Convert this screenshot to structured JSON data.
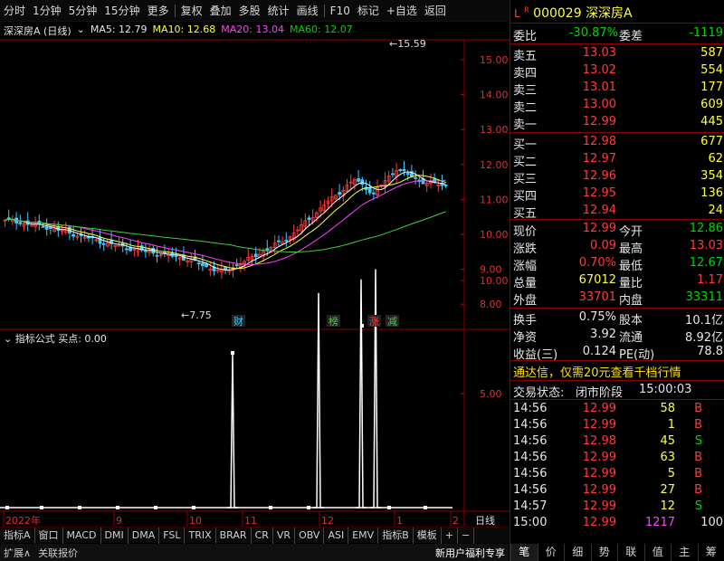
{
  "toolbar": {
    "items": [
      "分时",
      "1分钟",
      "5分钟",
      "15分钟",
      "更多",
      "复权",
      "叠加",
      "多股",
      "统计",
      "画线",
      "F10",
      "标记",
      "+自选",
      "返回"
    ]
  },
  "chart": {
    "stock": "深深房A (日线)",
    "ma5": "MA5: 12.79",
    "ma10": "MA10: 12.68",
    "ma20": "MA20: 13.04",
    "ma60": "MA60: 12.07",
    "high_label": "15.59",
    "low_label": "7.75",
    "price_ticks": [
      "15.00",
      "14.00",
      "13.00",
      "12.00",
      "11.00",
      "10.00",
      "9.00",
      "8.00"
    ],
    "events": [
      "财",
      "榜",
      "涨",
      "减"
    ],
    "indicator_title": "指标公式",
    "indicator_value": "买点: 0.00",
    "ind_ticks": [
      "10.00",
      "5.00"
    ],
    "date_labels": [
      "2022年",
      "9",
      "10",
      "11",
      "12",
      "1",
      "2"
    ],
    "period": "日线",
    "colors": {
      "ma5": "#ffffff",
      "ma10": "#ffff40",
      "ma20": "#ff40ff",
      "ma60": "#40d040",
      "up": "#ff3b3b",
      "down": "#3ec8ff"
    }
  },
  "bottom_tabs": [
    "指标A",
    "窗口",
    "MACD",
    "DMI",
    "DMA",
    "FSL",
    "TRIX",
    "BRAR",
    "CR",
    "VR",
    "OBV",
    "ASI",
    "EMV",
    "指标B",
    "模板",
    "+",
    "−"
  ],
  "status": {
    "left1": "扩展∧",
    "left2": "关联报价",
    "right": "新用户福利专享"
  },
  "quote": {
    "code": "000029",
    "name": "深深房A",
    "flags": [
      "L",
      "R"
    ],
    "webi_label": "委比",
    "webi": "-30.87%",
    "weicha_label": "委差",
    "weicha": "-1119",
    "sell": [
      {
        "label": "卖五",
        "price": "13.03",
        "vol": "587"
      },
      {
        "label": "卖四",
        "price": "13.02",
        "vol": "554"
      },
      {
        "label": "卖三",
        "price": "13.01",
        "vol": "177"
      },
      {
        "label": "卖二",
        "price": "13.00",
        "vol": "609"
      },
      {
        "label": "卖一",
        "price": "12.99",
        "vol": "445"
      }
    ],
    "buy": [
      {
        "label": "买一",
        "price": "12.98",
        "vol": "677"
      },
      {
        "label": "买二",
        "price": "12.97",
        "vol": "62"
      },
      {
        "label": "买三",
        "price": "12.96",
        "vol": "354"
      },
      {
        "label": "买四",
        "price": "12.95",
        "vol": "136"
      },
      {
        "label": "买五",
        "price": "12.94",
        "vol": "24"
      }
    ],
    "stats": [
      {
        "l1": "现价",
        "v1": "12.99",
        "l2": "今开",
        "v2": "12.86",
        "c1": "red",
        "c2": "grn"
      },
      {
        "l1": "涨跌",
        "v1": "0.09",
        "l2": "最高",
        "v2": "13.03",
        "c1": "red",
        "c2": "red"
      },
      {
        "l1": "涨幅",
        "v1": "0.70%",
        "l2": "最低",
        "v2": "12.67",
        "c1": "red",
        "c2": "grn"
      },
      {
        "l1": "总量",
        "v1": "67012",
        "l2": "量比",
        "v2": "1.17",
        "c1": "yel",
        "c2": "red"
      },
      {
        "l1": "外盘",
        "v1": "33701",
        "l2": "内盘",
        "v2": "33311",
        "c1": "red",
        "c2": "grn"
      }
    ],
    "stats2": [
      {
        "l1": "换手",
        "v1": "0.75%",
        "l2": "股本",
        "v2": "10.1亿"
      },
      {
        "l1": "净资",
        "v1": "3.92",
        "l2": "流通",
        "v2": "8.92亿"
      },
      {
        "l1": "收益(三)",
        "v1": "0.124",
        "l2": "PE(动)",
        "v2": "78.8"
      }
    ],
    "ad": "通达信，仅需20元查看千档行情",
    "trade_state_label": "交易状态:",
    "trade_state": "闭市阶段",
    "trade_time": "15:00:03",
    "ticks": [
      {
        "t": "14:56",
        "p": "12.99",
        "v": "58",
        "s": "B"
      },
      {
        "t": "14:56",
        "p": "12.99",
        "v": "1",
        "s": "B"
      },
      {
        "t": "14:56",
        "p": "12.98",
        "v": "45",
        "s": "S"
      },
      {
        "t": "14:56",
        "p": "12.99",
        "v": "63",
        "s": "B"
      },
      {
        "t": "14:56",
        "p": "12.99",
        "v": "5",
        "s": "B"
      },
      {
        "t": "14:56",
        "p": "12.99",
        "v": "27",
        "s": "B"
      },
      {
        "t": "14:57",
        "p": "12.99",
        "v": "12",
        "s": "S"
      },
      {
        "t": "15:00",
        "p": "12.99",
        "v": "1217",
        "s": "100"
      }
    ],
    "tabs": [
      "笔",
      "价",
      "细",
      "势",
      "联",
      "值",
      "主",
      "筹"
    ]
  }
}
